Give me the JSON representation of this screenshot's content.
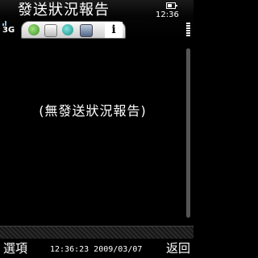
{
  "title": "發送狀況報告",
  "status": {
    "clock": "12:36",
    "network": "3G"
  },
  "toolbar": {
    "tabs": [
      {
        "icon": "green-circle-icon"
      },
      {
        "icon": "document-icon"
      },
      {
        "icon": "teal-circle-icon"
      },
      {
        "icon": "folder-icon"
      }
    ],
    "info_label": "i"
  },
  "content": {
    "empty_message": "(無發送狀況報告)"
  },
  "softkeys": {
    "left": "選項",
    "right": "返回"
  },
  "timestamp": "12:36:23 2009/03/07"
}
